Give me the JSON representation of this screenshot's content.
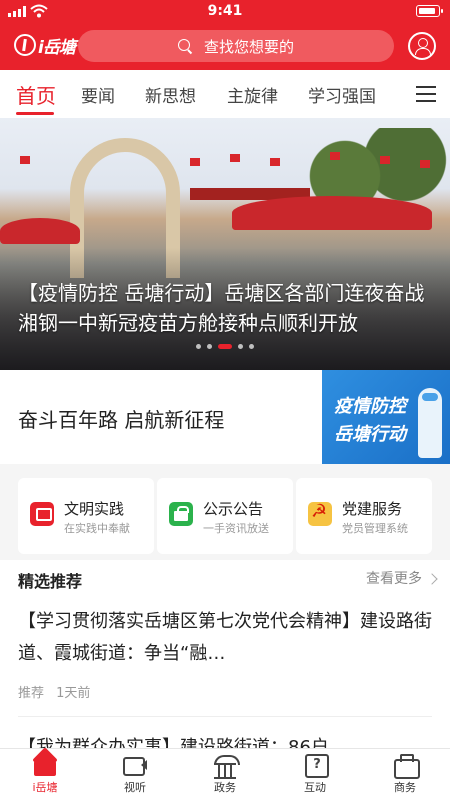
{
  "status_bar": {
    "time": "9:41",
    "battery_level": 0.9
  },
  "header": {
    "logo_text": "i岳塘",
    "search_placeholder": "查找您想要的",
    "icons": [
      "search-icon",
      "user-icon"
    ]
  },
  "tabs": [
    {
      "label": "首页",
      "active": true
    },
    {
      "label": "要闻"
    },
    {
      "label": "新思想"
    },
    {
      "label": "主旋律"
    },
    {
      "label": "学习强国"
    }
  ],
  "banner": {
    "title": "【疫情防控 岳塘行动】岳塘区各部门连夜奋战 湘钢一中新冠疫苗方舱接种点顺利开放",
    "slide_count": 5,
    "active_slide": 2
  },
  "slogan": {
    "text": "奋斗百年路 启航新征程",
    "image_line1": "疫情防控",
    "image_line2": "岳塘行动"
  },
  "services": [
    {
      "title": "文明实践",
      "subtitle": "在实践中奉献",
      "icon": "civilization-icon",
      "color": "#e8222c"
    },
    {
      "title": "公示公告",
      "subtitle": "一手资讯放送",
      "icon": "notice-icon",
      "color": "#2bb24c"
    },
    {
      "title": "党建服务",
      "subtitle": "党员管理系统",
      "icon": "party-icon",
      "color": "#f6c342"
    }
  ],
  "featured": {
    "title": "精选推荐",
    "more_label": "查看更多",
    "articles": [
      {
        "title": "【学习贯彻落实岳塘区第七次党代会精神】建设路街道、霞城街道：争当“融…",
        "tag": "推荐",
        "time": "1天前"
      },
      {
        "title": "【我为群众办实事】建设路街道：86户"
      }
    ]
  },
  "bottom_nav": [
    {
      "label": "i岳塘",
      "icon": "home-icon",
      "active": true
    },
    {
      "label": "视听",
      "icon": "video-icon"
    },
    {
      "label": "政务",
      "icon": "government-icon"
    },
    {
      "label": "互动",
      "icon": "interaction-icon"
    },
    {
      "label": "商务",
      "icon": "business-icon"
    }
  ],
  "colors": {
    "brand": "#e8222c",
    "search_bg": "#f05a5f"
  }
}
